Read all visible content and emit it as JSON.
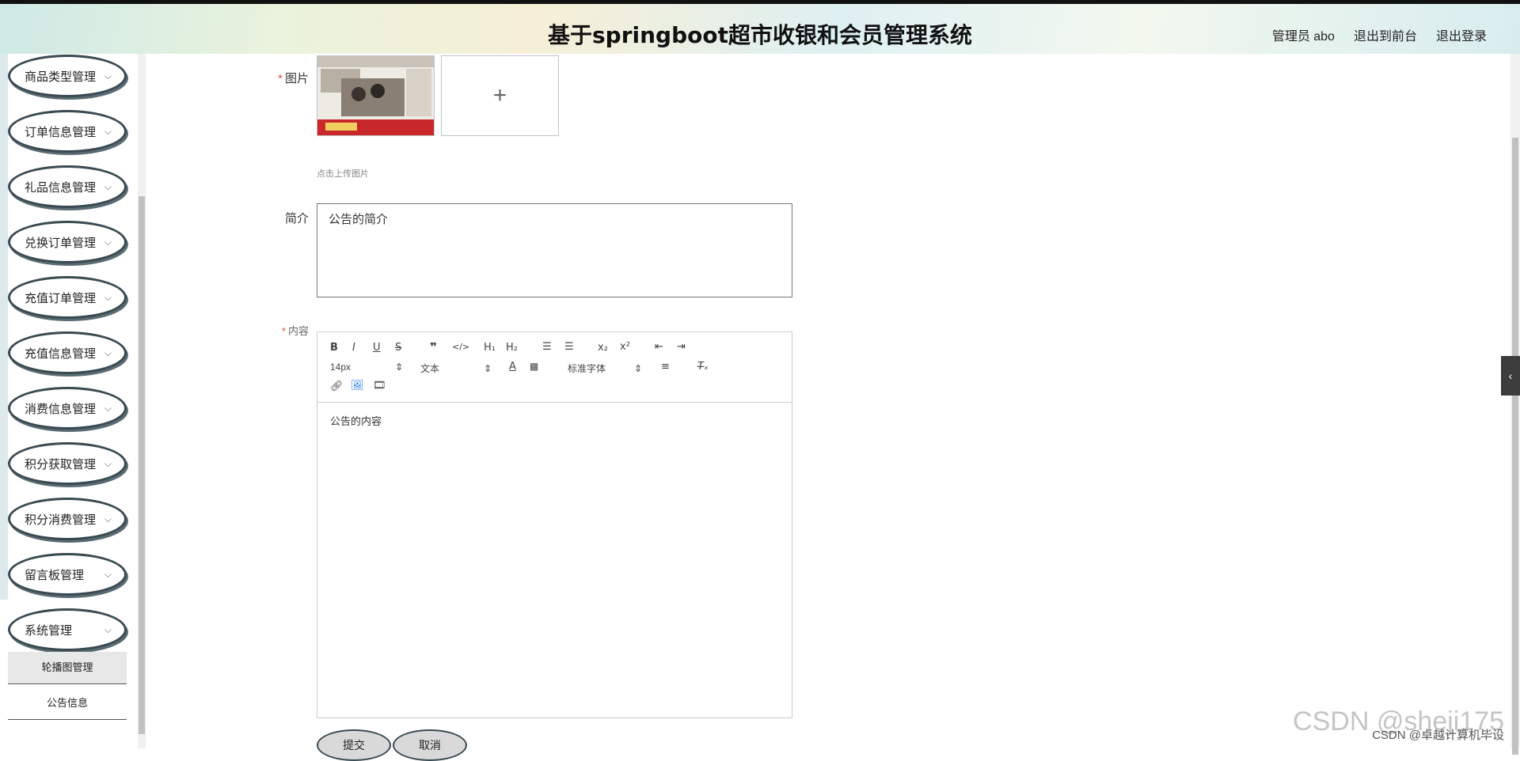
{
  "header": {
    "title": "基于springboot超市收银和会员管理系统",
    "user": "管理员 abo",
    "to_front": "退出到前台",
    "logout": "退出登录"
  },
  "sidebar": {
    "items": [
      {
        "label": "商品类型管理"
      },
      {
        "label": "订单信息管理"
      },
      {
        "label": "礼品信息管理"
      },
      {
        "label": "兑换订单管理"
      },
      {
        "label": "充值订单管理"
      },
      {
        "label": "充值信息管理"
      },
      {
        "label": "消费信息管理"
      },
      {
        "label": "积分获取管理"
      },
      {
        "label": "积分消费管理"
      },
      {
        "label": "留言板管理"
      },
      {
        "label": "系统管理"
      }
    ],
    "sub_items": [
      {
        "label": "轮播图管理",
        "active": true
      },
      {
        "label": "公告信息",
        "active": false
      }
    ]
  },
  "form": {
    "image_label": "图片",
    "upload_hint": "点击上传图片",
    "intro_label": "简介",
    "intro_value": "公告的简介",
    "content_label": "内容",
    "content_value": "公告的内容",
    "submit": "提交",
    "cancel": "取消"
  },
  "editor_toolbar": {
    "font_size": "14px",
    "text_style": "文本",
    "font_family": "标准字体"
  },
  "watermark": {
    "big": "CSDN @sheji175",
    "small": "CSDN @卓越计算机毕设"
  }
}
